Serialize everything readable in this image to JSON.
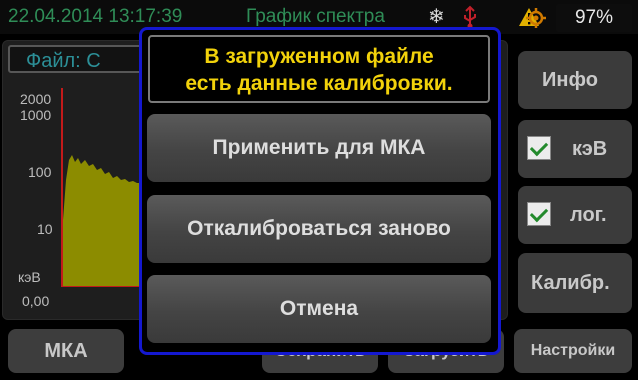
{
  "status": {
    "datetime": "22.04.2014  13:17:39",
    "title": "График спектра",
    "battery": "97%",
    "icons": [
      "snowflake-icon",
      "usb-icon",
      "warning-icon",
      "gps-icon"
    ]
  },
  "spectrum": {
    "file_label": "Файл: С",
    "y_ticks": [
      "2000",
      "1000",
      "100",
      "10"
    ],
    "x_unit": "кэВ",
    "x_start": "0,00",
    "bar_color": "#8c8c00"
  },
  "sidebar": {
    "info": "Инфо",
    "kev": "кэВ",
    "kev_checked": true,
    "log": "лог.",
    "log_checked": true,
    "calib": "Калибр."
  },
  "bottom": {
    "mka": "МКА",
    "save": "Сохранить",
    "load": "Загрузить",
    "settings": "Настройки"
  },
  "dialog": {
    "message_line1": "В загруженном файле",
    "message_line2": "есть данные калибровки.",
    "apply": "Применить для МКА",
    "recalibrate": "Откалиброваться заново",
    "cancel": "Отмена"
  },
  "colors": {
    "status_text": "#2f8d57",
    "message_text": "#f2d20b",
    "dialog_border": "#1418d0",
    "axis": "#c31a1a"
  }
}
